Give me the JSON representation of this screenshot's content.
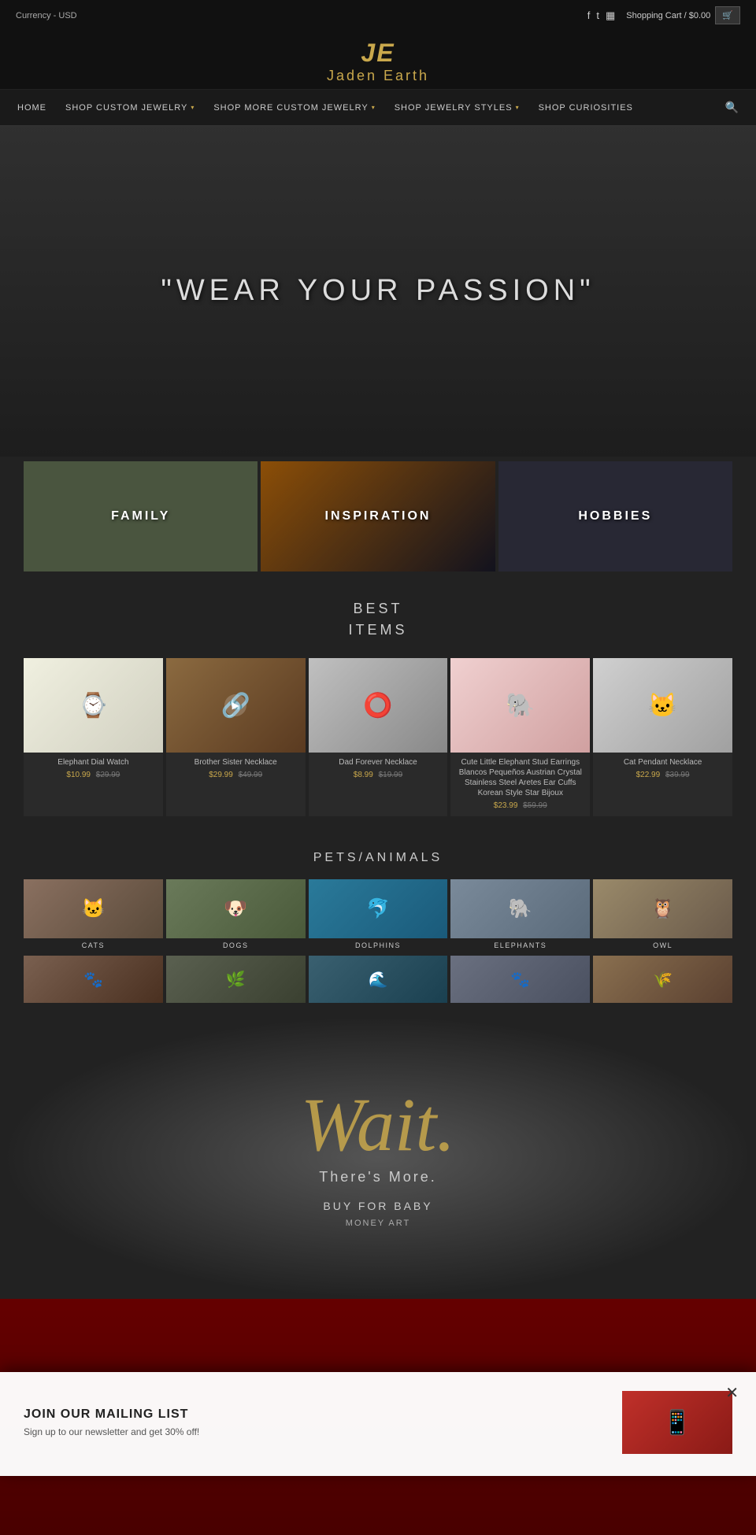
{
  "topbar": {
    "currency_label": "Currency - USD",
    "cart_label": "Shopping Cart / $0.00"
  },
  "logo": {
    "initials": "JE",
    "name": "Jaden Earth"
  },
  "nav": {
    "items": [
      {
        "id": "home",
        "label": "HOME"
      },
      {
        "id": "shop-custom",
        "label": "SHOP CUSTOM JEWELRY"
      },
      {
        "id": "shop-more",
        "label": "SHOP MORE CUSTOM JEWELRY"
      },
      {
        "id": "jewelry-styles",
        "label": "SHOP JEWELRY STYLES"
      },
      {
        "id": "curiosities",
        "label": "SHOP CURIOSITIES"
      }
    ]
  },
  "hero": {
    "quote": "\"WEAR YOUR PASSION\""
  },
  "categories": [
    {
      "id": "family",
      "label": "FAMILY"
    },
    {
      "id": "inspiration",
      "label": "INSPIRATION"
    },
    {
      "id": "hobbies",
      "label": "HOBBIES"
    }
  ],
  "best_items": {
    "title": "BEST\nITEMS",
    "products": [
      {
        "id": "elephant-watch",
        "name": "Elephant Dial Watch",
        "price": "$10.99",
        "original": "$29.99",
        "icon": "🐘"
      },
      {
        "id": "brother-sister",
        "name": "Brother Sister Necklace",
        "price": "$29.99",
        "original": "$49.99",
        "icon": "🔗"
      },
      {
        "id": "dad-necklace",
        "name": "Dad Forever Necklace",
        "price": "$8.99",
        "original": "$19.99",
        "icon": "⭕"
      },
      {
        "id": "elephant-earrings",
        "name": "Cute Little Elephant Stud Earrings Blancos Pequeños Austrian Crystal Stainless Steel Aretes Ear Cuffs Korean Style Star Bijoux",
        "price": "$23.99",
        "original": "$59.99",
        "icon": "🐘"
      },
      {
        "id": "cat-necklace",
        "name": "Cat Pendant Necklace",
        "price": "$22.99",
        "original": "$39.99",
        "icon": "🐱"
      }
    ]
  },
  "pets_animals": {
    "title": "PETS/ANIMALS",
    "categories": [
      {
        "id": "cats",
        "label": "CATS",
        "icon": "🐱"
      },
      {
        "id": "dogs",
        "label": "DOGS",
        "icon": "🐶"
      },
      {
        "id": "dolphins",
        "label": "DOLPHINS",
        "icon": "🐬"
      },
      {
        "id": "elephants",
        "label": "ELEPHANTS",
        "icon": "🐘"
      },
      {
        "id": "owl",
        "label": "OWL",
        "icon": "🦉"
      }
    ]
  },
  "wait_section": {
    "wait_text": "Wait.",
    "more_text": "There's More.",
    "baby_label": "BUY FOR BABY",
    "money_label": "MONEY ART"
  },
  "newsletter": {
    "title": "JOIN OUR MAILING LIST",
    "subtitle": "Sign up to our newsletter and get 30% off!"
  }
}
